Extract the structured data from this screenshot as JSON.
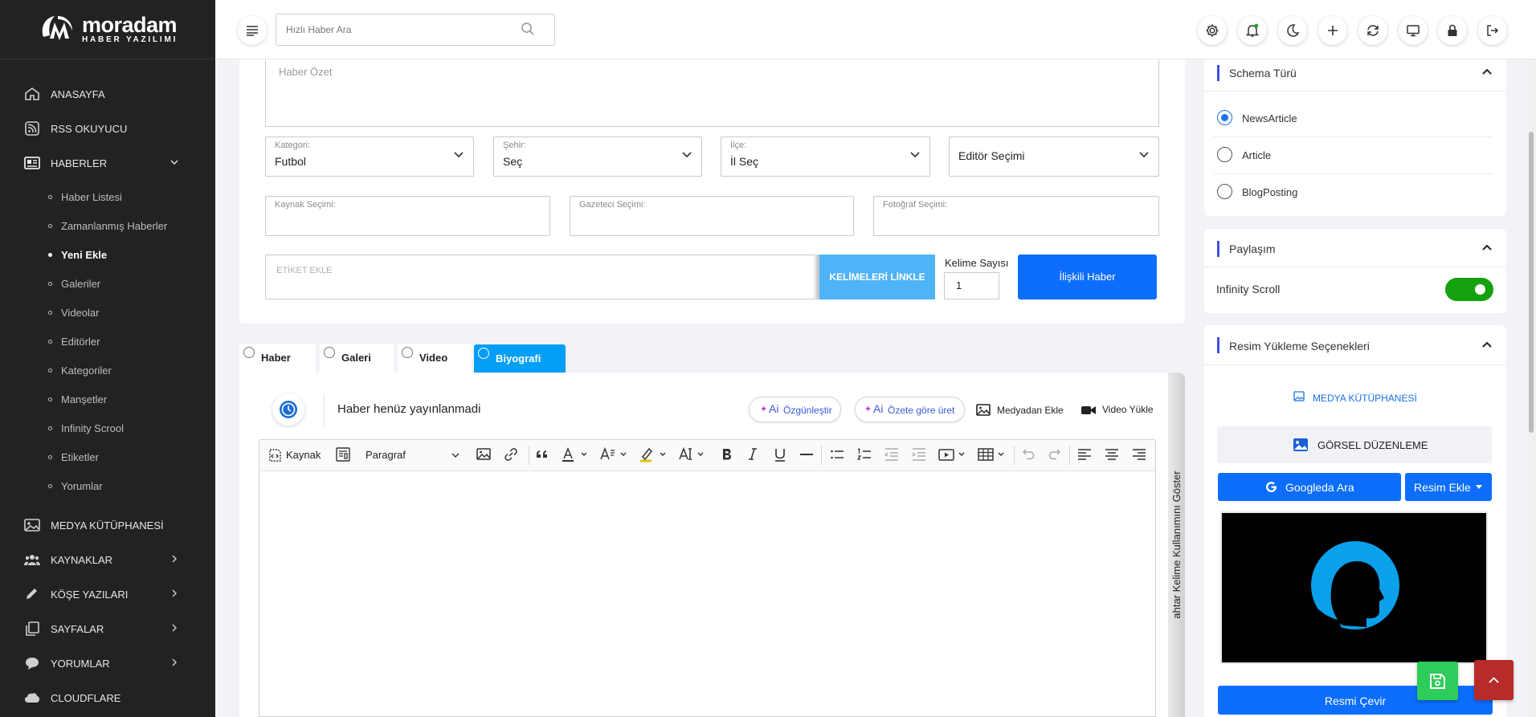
{
  "brand": {
    "name": "moradam",
    "tagline": "HABER YAZILIMI"
  },
  "sidebar": {
    "items": [
      {
        "label": "ANASAYFA",
        "icon": "home-icon"
      },
      {
        "label": "RSS OKUYUCU",
        "icon": "rss-icon"
      },
      {
        "label": "HABERLER",
        "icon": "newspaper-icon",
        "expanded": true
      },
      {
        "label": "MEDYA KÜTÜPHANESİ",
        "icon": "image-icon"
      },
      {
        "label": "KAYNAKLAR",
        "icon": "users-icon"
      },
      {
        "label": "KÖŞE YAZILARI",
        "icon": "pen-icon"
      },
      {
        "label": "SAYFALAR",
        "icon": "pages-icon"
      },
      {
        "label": "YORUMLAR",
        "icon": "comment-icon"
      },
      {
        "label": "CLOUDFLARE",
        "icon": "cloud-icon"
      }
    ],
    "sub_items": [
      "Haber Listesi",
      "Zamanlanmış Haberler",
      "Yeni Ekle",
      "Galeriler",
      "Videolar",
      "Editörler",
      "Kategoriler",
      "Manşetler",
      "Infinity Scrool",
      "Etiketler",
      "Yorumlar"
    ],
    "active_sub": "Yeni Ekle"
  },
  "header": {
    "search_placeholder": "Hızlı Haber Ara",
    "icons": [
      "gear-icon",
      "bell-icon",
      "moon-icon",
      "plus-icon",
      "refresh-icon",
      "monitor-icon",
      "lock-icon",
      "logout-icon"
    ]
  },
  "form": {
    "summary_placeholder": "Haber Özet",
    "kategori": {
      "label": "Kategori:",
      "value": "Futbol"
    },
    "sehir": {
      "label": "Şehir:",
      "value": "Seç"
    },
    "ilce": {
      "label": "İlçe:",
      "value": "İl Seç"
    },
    "editor": {
      "value": "Editör Seçimi"
    },
    "kaynak_label": "Kaynak Seçimi:",
    "gazeteci_label": "Gazeteci Seçimi:",
    "fotograf_label": "Fotoğraf Seçimi:",
    "etiket_placeholder": "ETİKET EKLE",
    "link_words_label": "KELİMELERİ LİNKLE",
    "word_count_label": "Kelime Sayısı",
    "word_count_value": "1",
    "related_label": "İlişkili Haber"
  },
  "tabs": [
    {
      "label": "Haber",
      "active": false
    },
    {
      "label": "Galeri",
      "active": false
    },
    {
      "label": "Video",
      "active": false
    },
    {
      "label": "Biyografi",
      "active": true
    }
  ],
  "editor": {
    "status_text": "Haber henüz yayınlanmadi",
    "ai_button_1": "Özgünleştir",
    "ai_button_1_prefix": "Ai",
    "ai_button_2": "Özete göre üret",
    "ai_button_2_prefix": "Ai",
    "media_add": "Medyadan Ekle",
    "video_upload": "Video Yükle",
    "toolbar": {
      "source": "Kaynak",
      "paragraph": "Paragraf"
    },
    "side_label": "ahtar Kelime Kullanımını Göster"
  },
  "right_panel": {
    "schema": {
      "title": "Schema Türü",
      "options": [
        "NewsArticle",
        "Article",
        "BlogPosting"
      ],
      "selected": "NewsArticle"
    },
    "sharing": {
      "title": "Paylaşım",
      "infinity_label": "Infinity Scroll",
      "infinity_on": true
    },
    "image": {
      "title": "Resim Yükleme Seçenekleri",
      "media_library": "MEDYA KÜTÜPHANESİ",
      "visual_edit": "GÖRSEL DÜZENLEME",
      "google_search": "Googleda Ara",
      "add_image": "Resim Ekle",
      "rotate": "Resmi Çevir"
    }
  },
  "colors": {
    "sidebar_bg": "#222222",
    "primary": "#0d6efd",
    "accent_blue": "#039ef6",
    "toggle_green": "#13a10e",
    "save_green": "#2ecc5a",
    "top_red": "#b72b2b"
  }
}
